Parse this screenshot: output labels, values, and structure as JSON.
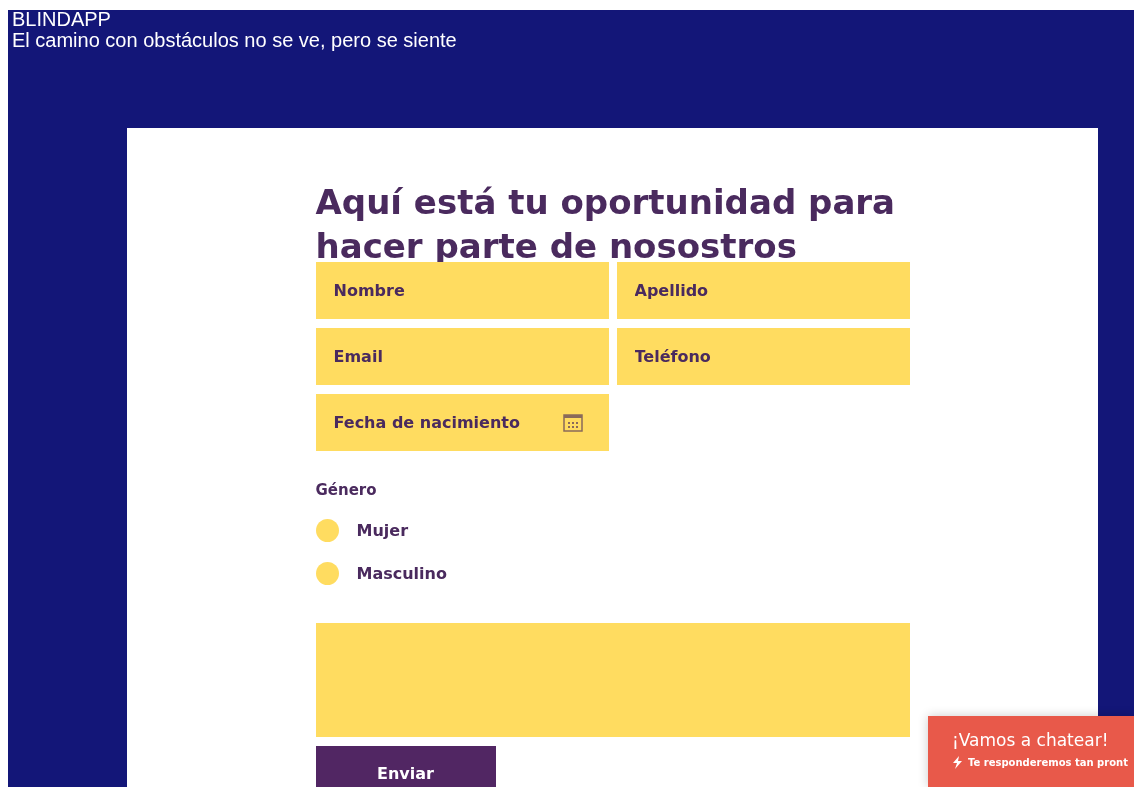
{
  "header": {
    "title": "BLINDAPP",
    "tagline": "El camino con obstáculos no se ve, pero se siente"
  },
  "form": {
    "heading": "Aquí está tu oportunidad para hacer parte de nosostros",
    "fields": [
      {
        "placeholder": "Nombre",
        "kind": "text"
      },
      {
        "placeholder": "Apellido",
        "kind": "text"
      },
      {
        "placeholder": "Email",
        "kind": "text"
      },
      {
        "placeholder": "Teléfono",
        "kind": "text"
      },
      {
        "placeholder": "Fecha de nacimiento",
        "kind": "date"
      }
    ],
    "gender": {
      "label": "Género",
      "options": [
        {
          "label": "Mujer",
          "selected": false
        },
        {
          "label": "Masculino",
          "selected": false
        }
      ]
    },
    "submit": "Enviar"
  },
  "chat": {
    "title": "¡Vamos a chatear!",
    "subtitle": "Te responderemos tan pront"
  }
}
